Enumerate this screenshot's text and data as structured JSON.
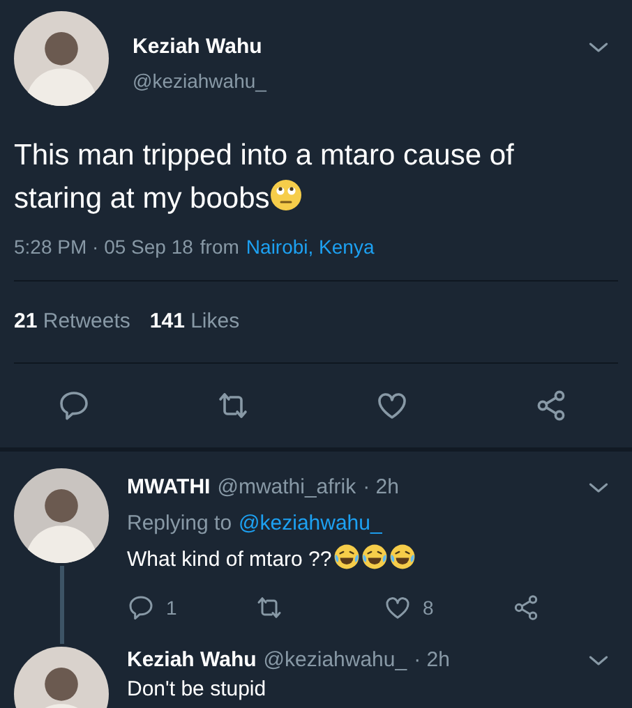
{
  "tweet": {
    "name": "Keziah Wahu",
    "handle": "@keziahwahu_",
    "text": "This man tripped into a mtaro cause of staring at my boobs",
    "time": "5:28 PM · 05 Sep 18",
    "from": "from",
    "location": "Nairobi, Kenya"
  },
  "stats": [
    {
      "count": "21",
      "label": "Retweets"
    },
    {
      "count": "141",
      "label": "Likes"
    }
  ],
  "replies": [
    {
      "name": "MWATHI",
      "handle": "@mwathi_afrik",
      "age": "· 2h",
      "replying_label": "Replying to",
      "replying_to": "@keziahwahu_",
      "text": "What kind of mtaro ??",
      "emojis": [
        {
          "kind": "laughing"
        },
        {
          "kind": "laughing"
        },
        {
          "kind": "laughing"
        }
      ],
      "reply_count": "1",
      "like_count": "8",
      "thread_line": true
    },
    {
      "name": "Keziah Wahu",
      "handle": "@keziahwahu_",
      "age": "· 2h",
      "text": "Don't be stupid",
      "thread_line": false
    }
  ]
}
